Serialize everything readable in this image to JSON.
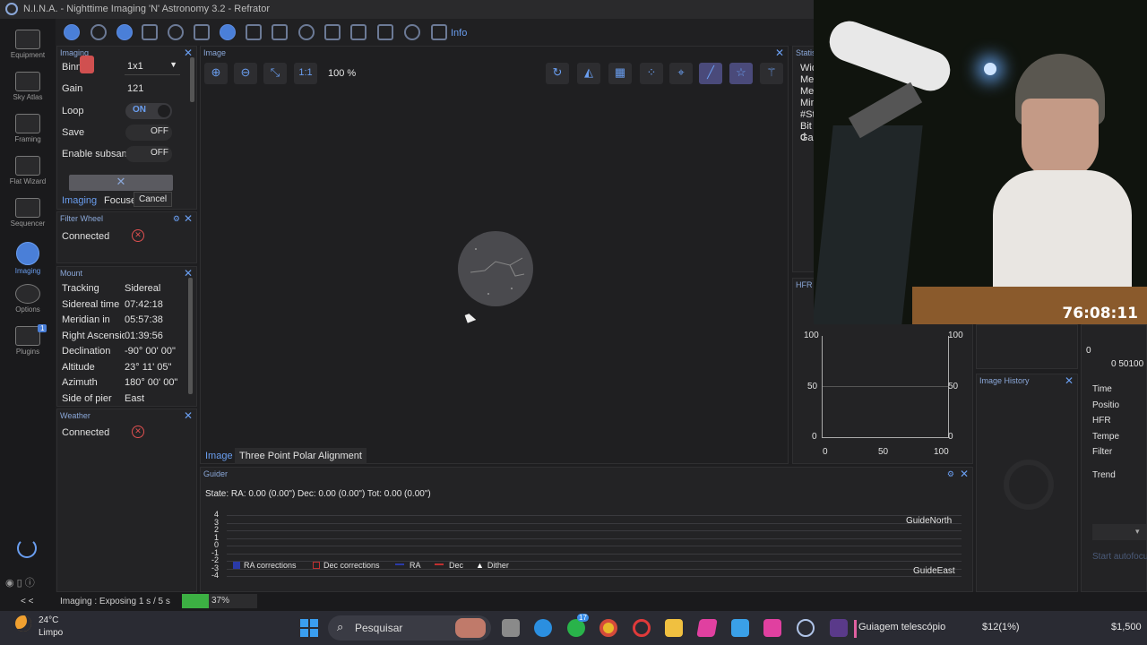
{
  "window": {
    "title": "N.I.N.A. - Nighttime Imaging 'N' Astronomy 3.2  -  Refrator"
  },
  "sidebar": {
    "items": [
      {
        "label": "Equipment"
      },
      {
        "label": "Sky Atlas"
      },
      {
        "label": "Framing"
      },
      {
        "label": "Flat Wizard"
      },
      {
        "label": "Sequencer"
      },
      {
        "label": "Imaging"
      },
      {
        "label": "Options"
      },
      {
        "label": "Plugins",
        "badge": "1"
      }
    ]
  },
  "toolbar": {
    "info_label": "Info"
  },
  "imaging_panel": {
    "title": "Imaging",
    "bin_label": "Binning",
    "bin_value": "1x1",
    "gain_label": "Gain",
    "gain_value": "121",
    "loop_label": "Loop",
    "loop_value": "ON",
    "save_label": "Save",
    "save_value": "OFF",
    "subsample_label": "Enable subsam",
    "subsample_value": "OFF",
    "cancel_label": "Cancel",
    "tabs": [
      {
        "label": "Imaging"
      },
      {
        "label": "Focuser"
      }
    ]
  },
  "filter_wheel": {
    "title": "Filter Wheel",
    "status_label": "Connected"
  },
  "mount": {
    "title": "Mount",
    "rows": [
      {
        "label": "Tracking",
        "value": "Sidereal"
      },
      {
        "label": "Sidereal time",
        "value": "07:42:18"
      },
      {
        "label": "Meridian in",
        "value": "05:57:38"
      },
      {
        "label": "Right Ascension",
        "value": "01:39:56"
      },
      {
        "label": "Declination",
        "value": "-90° 00' 00\""
      },
      {
        "label": "Altitude",
        "value": "23° 11' 05\""
      },
      {
        "label": "Azimuth",
        "value": "180° 00' 00\""
      },
      {
        "label": "Side of pier",
        "value": "East"
      }
    ]
  },
  "weather": {
    "title": "Weather",
    "status_label": "Connected"
  },
  "image_panel": {
    "title": "Image",
    "zoom_label": "100 %",
    "one_to_one": "1:1",
    "tabs": [
      {
        "label": "Image"
      },
      {
        "label": "Three Point Polar Alignment"
      }
    ]
  },
  "statistics": {
    "title": "Statistics",
    "rows": [
      "Wid",
      "Mea",
      "Med",
      "Min",
      "#Sta",
      "Bit d",
      "Gain"
    ]
  },
  "hfr_panel": {
    "title": "HFR History",
    "y_left": [
      "100",
      "50",
      "0"
    ],
    "y_right": [
      "100",
      "50",
      "0"
    ],
    "x": [
      "0",
      "50",
      "100"
    ]
  },
  "image_history": {
    "title": "Image History"
  },
  "right_panel": {
    "labels": [
      "Time",
      "Positio",
      "HFR",
      "Tempe",
      "Filter"
    ],
    "trend_label": "Trend",
    "start_label": "Start autofocus",
    "axis_zero": "0",
    "axis_x": "0 50100"
  },
  "guider": {
    "title": "Guider",
    "state": "State:  RA: 0.00 (0.00\")  Dec: 0.00 (0.00\")  Tot: 0.00 (0.00\")",
    "y_ticks": [
      "4",
      "3",
      "2",
      "1",
      "0",
      "-1",
      "-2",
      "-3",
      "-4"
    ],
    "north_label": "GuideNorth",
    "east_label": "GuideEast",
    "legend": [
      {
        "label": "RA corrections",
        "color": "#2a3aa8"
      },
      {
        "label": "Dec corrections",
        "color": "#c03030"
      },
      {
        "label": "RA",
        "color": "#2a3aa8"
      },
      {
        "label": "Dec",
        "color": "#c03030"
      },
      {
        "label": "Dither",
        "color": "#ffffff"
      }
    ]
  },
  "status_bar": {
    "collapse": "< <",
    "text": "Imaging :   Exposing 1 s / 5 s",
    "progress_percent": 37,
    "progress_label": "37%"
  },
  "stream_timer": "76:08:11",
  "taskbar": {
    "weather_temp": "24°C",
    "weather_desc": "Limpo",
    "search_placeholder": "Pesquisar",
    "whatsapp_badge": "17",
    "title_item": "Guiagem telescópio",
    "price1": "$12(1%)",
    "price2": "$1,500"
  },
  "colors": {
    "accent": "#6a9ef0",
    "panel": "#232325",
    "bg": "#1e1e20",
    "error": "#e05050",
    "progress": "#3cb043"
  }
}
